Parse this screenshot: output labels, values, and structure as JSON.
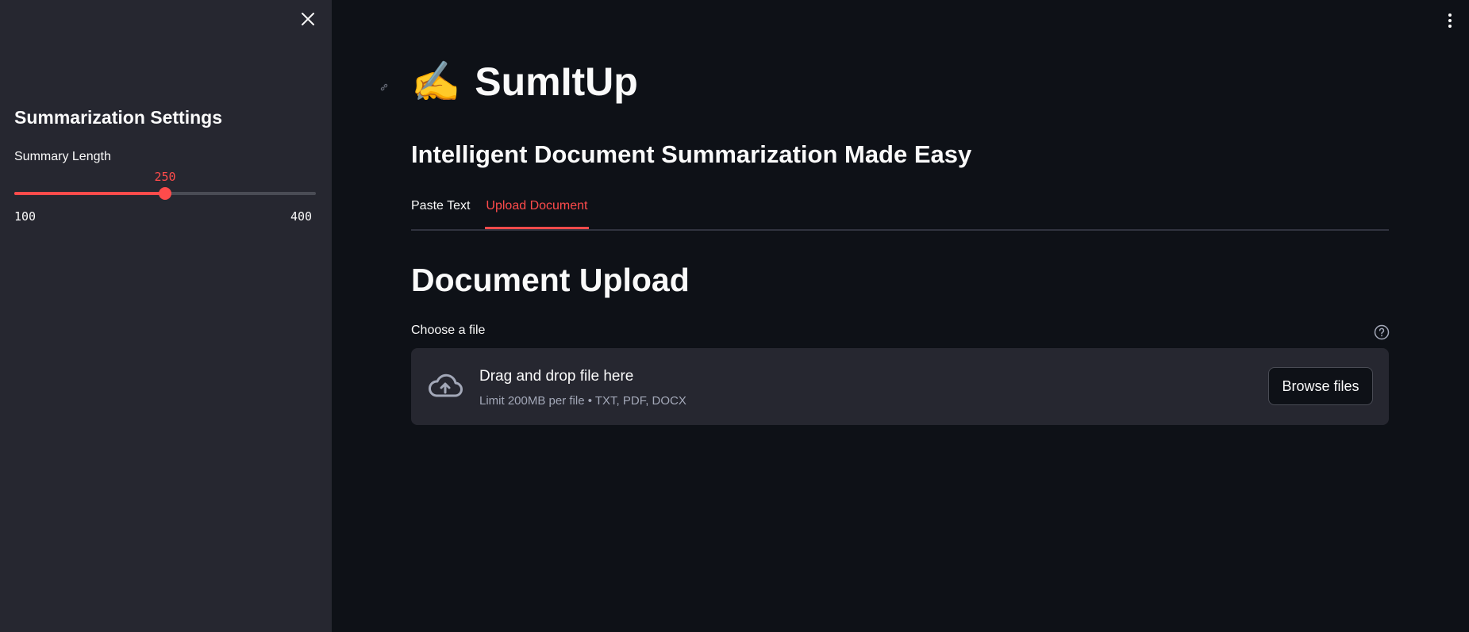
{
  "sidebar": {
    "title": "Summarization Settings",
    "slider": {
      "label": "Summary Length",
      "value": 250,
      "min": 100,
      "max": 400,
      "value_text": "250",
      "min_text": "100",
      "max_text": "400"
    }
  },
  "main": {
    "title": "SumItUp",
    "title_emoji": "✍️",
    "subtitle": "Intelligent Document Summarization Made Easy",
    "tabs": [
      {
        "label": "Paste Text",
        "active": false
      },
      {
        "label": "Upload Document",
        "active": true
      }
    ],
    "section_title": "Document Upload",
    "uploader": {
      "label": "Choose a file",
      "drop_text": "Drag and drop file here",
      "limit_text": "Limit 200MB per file • TXT, PDF, DOCX",
      "button_label": "Browse files"
    }
  },
  "colors": {
    "background": "#0e1117",
    "sidebar": "#262730",
    "accent": "#ff4b4b",
    "text": "#fafafa",
    "muted": "#a3a8b8"
  },
  "icons": {
    "close": "close-icon",
    "menu": "kebab-menu-icon",
    "help": "help-icon",
    "upload": "cloud-upload-icon",
    "anchor": "link-icon"
  }
}
